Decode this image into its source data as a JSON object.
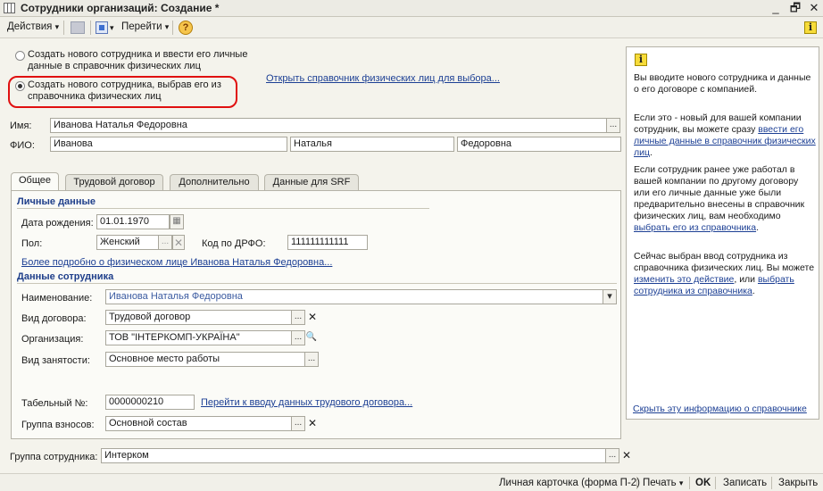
{
  "window": {
    "title": "Сотрудники организаций: Создание *",
    "minimize": "_",
    "restore": "🗗",
    "close": "✕"
  },
  "toolbar": {
    "actions_label": "Действия",
    "goto_label": "Перейти",
    "help_glyph": "?",
    "info_glyph": "i",
    "dropdown_glyph": "▾"
  },
  "mode": {
    "option1": "Создать нового сотрудника и ввести его личные данные в справочник физических лиц",
    "option2": "Создать нового сотрудника, выбрав его из справочника физических лиц",
    "selected": "option2",
    "open_directory_link": "Открыть справочник физических лиц для выбора..."
  },
  "person": {
    "name_label": "Имя:",
    "name_value": "Иванова Наталья Федоровна",
    "fio_label": "ФИО:",
    "surname": "Иванова",
    "first_name": "Наталья",
    "patronymic": "Федоровна"
  },
  "tabs": [
    "Общее",
    "Трудовой договор",
    "Дополнительно",
    "Данные для SRF"
  ],
  "active_tab": "Общее",
  "personal": {
    "section_title": "Личные данные",
    "birth_label": "Дата рождения:",
    "birth_value": "01.01.1970",
    "gender_label": "Пол:",
    "gender_value": "Женский",
    "drfo_label": "Код по ДРФО:",
    "drfo_value": "111111111111",
    "more_link": "Более подробно о физическом лице Иванова Наталья Федоровна..."
  },
  "employee": {
    "section_title": "Данные сотрудника",
    "naming_label": "Наименование:",
    "naming_value": "Иванова Наталья Федоровна",
    "contract_type_label": "Вид договора:",
    "contract_type_value": "Трудовой договор",
    "org_label": "Организация:",
    "org_value": "ТОВ \"ІНТЕРКОМП-УКРАЇНА\"",
    "employment_label": "Вид занятости:",
    "employment_value": "Основное место работы",
    "tabno_label": "Табельный №:",
    "tabno_value": "0000000210",
    "contract_link": "Перейти к вводу данных трудового договора...",
    "contrib_label": "Группа взносов:",
    "contrib_value": "Основной состав"
  },
  "group": {
    "label": "Группа сотрудника:",
    "value": "Интерком"
  },
  "info_panel": {
    "p1": "Вы вводите нового сотрудника и данные о его договоре с компанией.",
    "p2_text": "Если это - новый для вашей компании сотрудник, вы можете сразу ",
    "p2_link": "ввести его личные данные в справочник физических лиц",
    "p2_end": ".",
    "p3_text": "Если сотрудник ранее уже работал в вашей компании по другому договору или его личные данные уже были предварительно внесены в справочник физических лиц, вам необходимо ",
    "p3_link": "выбрать его из справочника",
    "p3_end": ".",
    "p4_text": "Сейчас выбран ввод сотрудника из справочника физических лиц. Вы можете ",
    "p4_link1": "изменить это действие",
    "p4_mid": ", или ",
    "p4_link2": "выбрать сотрудника из справочника",
    "p4_end": ".",
    "hide_link": "Скрыть эту информацию о справочнике"
  },
  "bottom": {
    "personal_card": "Личная карточка (форма П-2)",
    "print": "Печать",
    "ok": "OK",
    "save": "Записать",
    "close": "Закрыть"
  },
  "buttons": {
    "select_glyph": "...",
    "clear_glyph": "✕",
    "search_glyph": "🔍",
    "calendar_glyph": "▦",
    "dropdown_glyph": "▾"
  }
}
